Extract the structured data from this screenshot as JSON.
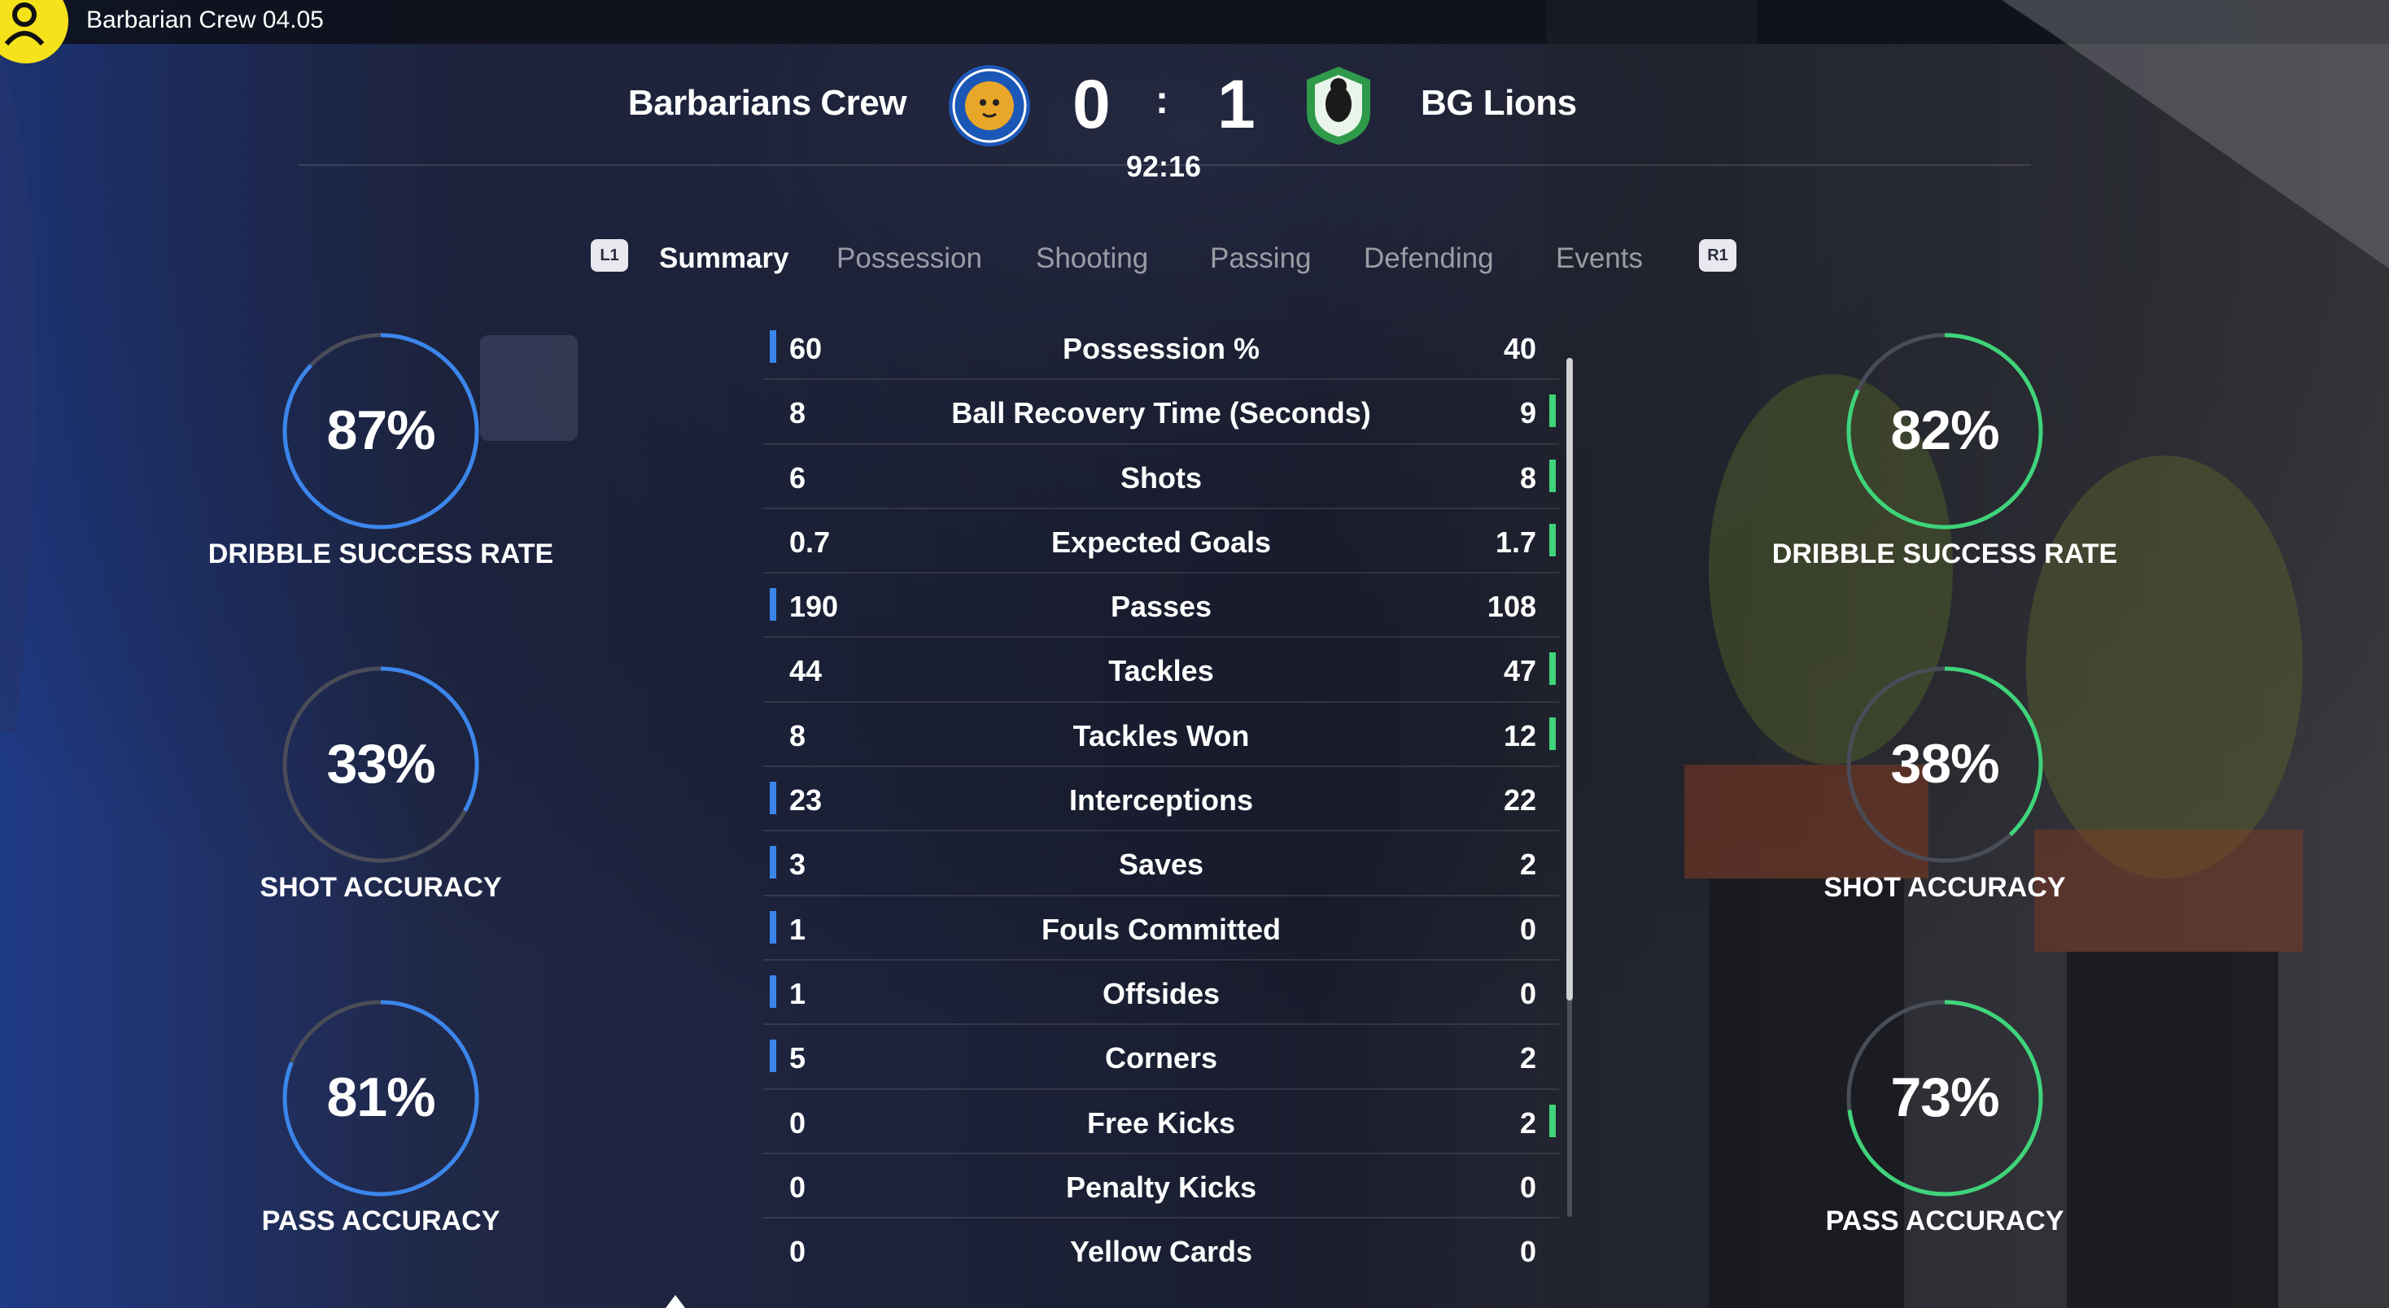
{
  "video": {
    "title": "Barbarian Crew 04.05"
  },
  "match": {
    "home_team": "Barbarians Crew",
    "away_team": "BG Lions",
    "home_score": "0",
    "away_score": "1",
    "separator": ":",
    "clock": "92:16"
  },
  "tabs": {
    "left_bumper": "L1",
    "right_bumper": "R1",
    "items": [
      "Summary",
      "Possession",
      "Shooting",
      "Passing",
      "Defending",
      "Events"
    ],
    "active": "Summary"
  },
  "home_rings": [
    {
      "value": "87%",
      "fraction": 0.87,
      "label": "DRIBBLE SUCCESS RATE"
    },
    {
      "value": "33%",
      "fraction": 0.33,
      "label": "SHOT ACCURACY"
    },
    {
      "value": "81%",
      "fraction": 0.81,
      "label": "PASS ACCURACY"
    }
  ],
  "away_rings": [
    {
      "value": "82%",
      "fraction": 0.82,
      "label": "DRIBBLE SUCCESS RATE"
    },
    {
      "value": "38%",
      "fraction": 0.38,
      "label": "SHOT ACCURACY"
    },
    {
      "value": "73%",
      "fraction": 0.73,
      "label": "PASS ACCURACY"
    }
  ],
  "colors": {
    "home": "#3b86ec",
    "away": "#3fd47a",
    "ring_track": "#4a4c58"
  },
  "stats": [
    {
      "label": "Possession %",
      "home": "60",
      "away": "40",
      "leader": "home"
    },
    {
      "label": "Ball Recovery Time (Seconds)",
      "home": "8",
      "away": "9",
      "leader": "away"
    },
    {
      "label": "Shots",
      "home": "6",
      "away": "8",
      "leader": "away"
    },
    {
      "label": "Expected Goals",
      "home": "0.7",
      "away": "1.7",
      "leader": "away"
    },
    {
      "label": "Passes",
      "home": "190",
      "away": "108",
      "leader": "home"
    },
    {
      "label": "Tackles",
      "home": "44",
      "away": "47",
      "leader": "away"
    },
    {
      "label": "Tackles Won",
      "home": "8",
      "away": "12",
      "leader": "away"
    },
    {
      "label": "Interceptions",
      "home": "23",
      "away": "22",
      "leader": "home"
    },
    {
      "label": "Saves",
      "home": "3",
      "away": "2",
      "leader": "home"
    },
    {
      "label": "Fouls Committed",
      "home": "1",
      "away": "0",
      "leader": "home"
    },
    {
      "label": "Offsides",
      "home": "1",
      "away": "0",
      "leader": "home"
    },
    {
      "label": "Corners",
      "home": "5",
      "away": "2",
      "leader": "home"
    },
    {
      "label": "Free Kicks",
      "home": "0",
      "away": "2",
      "leader": "away"
    },
    {
      "label": "Penalty Kicks",
      "home": "0",
      "away": "0",
      "leader": "none"
    },
    {
      "label": "Yellow Cards",
      "home": "0",
      "away": "0",
      "leader": "none"
    }
  ]
}
